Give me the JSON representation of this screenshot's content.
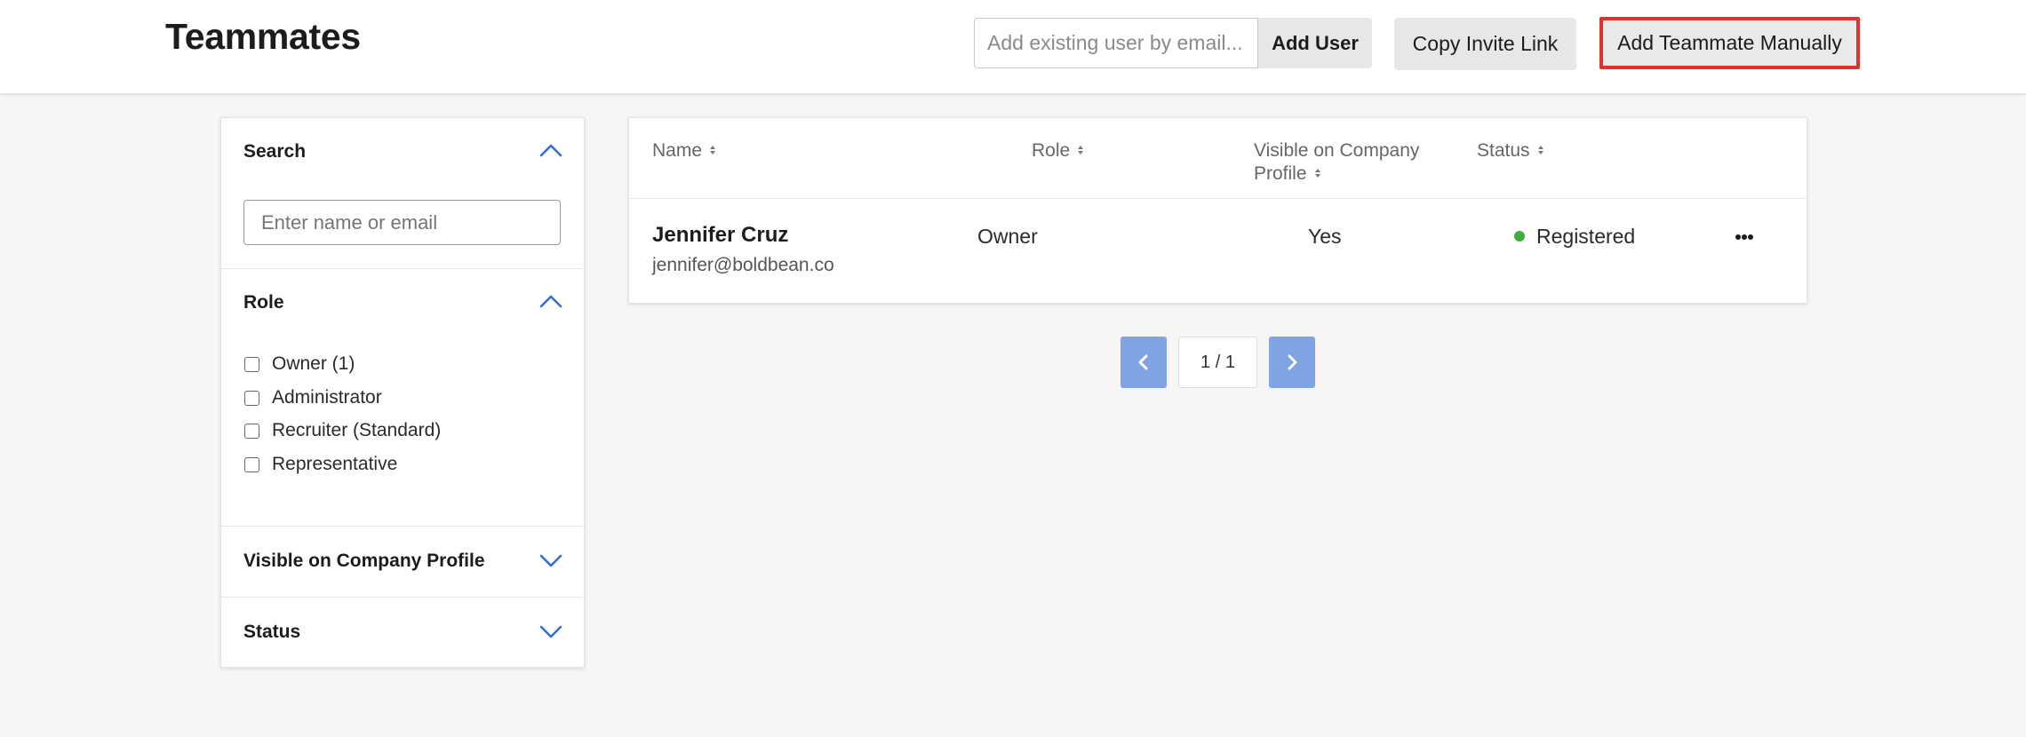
{
  "header": {
    "title": "Teammates",
    "email_placeholder": "Add existing user by email...",
    "add_user_label": "Add User",
    "copy_link_label": "Copy Invite Link",
    "add_manual_label": "Add Teammate Manually"
  },
  "filters": {
    "search": {
      "heading": "Search",
      "placeholder": "Enter name or email"
    },
    "role": {
      "heading": "Role",
      "options": [
        "Owner (1)",
        "Administrator",
        "Recruiter (Standard)",
        "Representative"
      ]
    },
    "visible": {
      "heading": "Visible on Company Profile"
    },
    "status": {
      "heading": "Status"
    }
  },
  "table": {
    "columns": {
      "name": "Name",
      "role": "Role",
      "visible_line1": "Visible on Company",
      "visible_line2": "Profile",
      "status": "Status"
    },
    "rows": [
      {
        "name": "Jennifer Cruz",
        "email": "jennifer@boldbean.co",
        "role": "Owner",
        "visible": "Yes",
        "status": "Registered"
      }
    ]
  },
  "pagination": {
    "display": "1 / 1"
  },
  "colors": {
    "accent_blue": "#2f6fdb",
    "status_registered": "#3fae3a",
    "highlight_red": "#e0312b",
    "pager_blue": "#7fa3e3"
  },
  "icons": {
    "collapse": "chevron-up-icon",
    "expand": "chevron-down-icon",
    "sort": "sort-icon",
    "more": "more-horizontal-icon",
    "prev": "chevron-left-icon",
    "next": "chevron-right-icon"
  }
}
